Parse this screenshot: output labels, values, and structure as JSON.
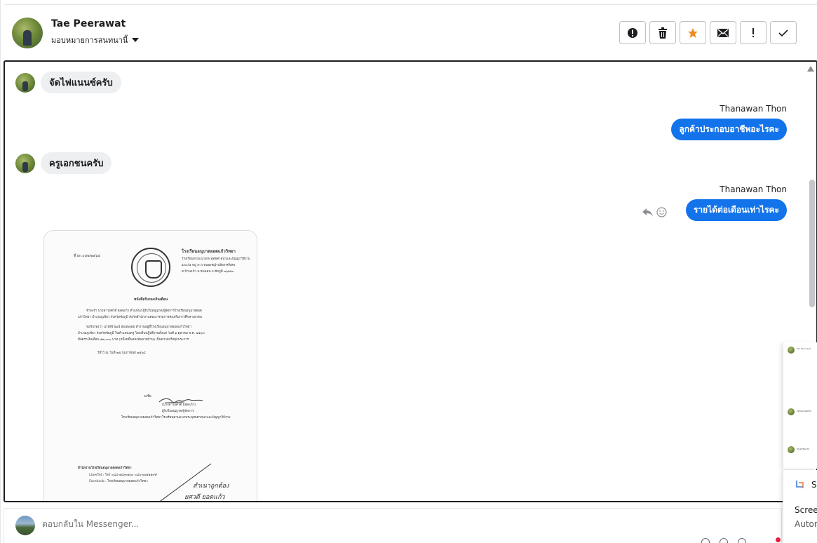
{
  "header": {
    "contact_name": "Tae Peerawat",
    "assign_label": "มอบหมายการสนทนานี้",
    "toolbar": [
      {
        "name": "spam-button",
        "icon": "alert-circle-icon"
      },
      {
        "name": "delete-button",
        "icon": "trash-icon"
      },
      {
        "name": "star-button",
        "icon": "star-icon",
        "color": "#f08a24"
      },
      {
        "name": "mark-unread-button",
        "icon": "envelope-icon"
      },
      {
        "name": "follow-up-button",
        "icon": "exclamation-icon"
      },
      {
        "name": "mark-done-button",
        "icon": "check-icon"
      }
    ]
  },
  "messages": [
    {
      "direction": "in",
      "text": "จัดไฟแนนซ์ครับ"
    },
    {
      "direction": "out",
      "sender": "Thanawan Thon",
      "text": "ลูกค้าประกอบอาชีพอะไรคะ"
    },
    {
      "direction": "in",
      "text": "ครูเอกชนครับ"
    },
    {
      "direction": "out",
      "sender": "Thanawan Thon",
      "text": "รายได้ต่อเดือนเท่าไรคะ"
    }
  ],
  "document": {
    "ref": "ที่ ยก.๐๔๒/๒๕๖๔",
    "school": "โรงเรียนอนุบาลยอดแก้ววิทยา",
    "addr1": "โรงเรียนตามแนวพระพุทธศาสนาและปัญญาวิถีงาม",
    "addr2": "๑๓๐/๕ หมู่ ๙ ถ.หนองหญ้าปล้อง-ศรีเทพ",
    "addr3": "ต.บ้านแก้ว อ.ชนแดน จ.ชัยภูมิ ๓๖๑๑๐",
    "heading": "หนังสือรับรองเงินเดือน",
    "p1a": "ข้าพเจ้า นางสาวยศวดี ยอดแก้ว ตำแหน่ง ผู้รับใบอนุญาต/ผู้จัดการโรงเรียนอนุบาลยอด",
    "p1b": "แก้ววิทยา อำเภอภูเขียว จังหวัดชัยภูมิ สังกัดสำนักงานคณะกรรมการส่งเสริมการศึกษาเอกชน",
    "p2a": "ขอรับรองว่า นายพีรวัฒน์ อ่อนพลอย ทำงานอยู่ที่โรงเรียนอนุบาลยอดแก้ววิทยา",
    "p2b": "อำเภอภูเขียว จังหวัดชัยภูมิ ในตำแหน่งครู โดยเริ่มปฏิบัติงานตั้งแต่ วันที่ ๑ ตุลาคม พ.ศ. ๒๕๖๓",
    "p2c": "มีอัตราเงินเดือน ๑๒,๐๐๐ บาท (หนึ่งหมื่นสองพันบาทถ้วน) เป็นความจริงทุกประการ",
    "date": "ให้ไว้ ณ วันที่ ๒๕ กุมภาพันธ์ ๒๕๖๔",
    "sig_label": "ลงชื่อ",
    "signer": "(นางสาวยศวดี ยอดแก้ว)",
    "signer_role": "ผู้รับใบอนุญาต/ผู้จัดการ",
    "signer_org": "โรงเรียนอนุบาลยอดแก้ววิทยาโรงเรียนตามแนวพระพุทธศาสนาและปัญญาวิถีงาม",
    "office": "สำนักงานโรงเรียนอนุบาลยอดแก้ววิทยา",
    "line_tel": "Line/Tel : โทร ๐๘๔-๑๔๓๐๑๖๐ ๐๘๖-๖๖๕๑๑๙๙",
    "facebook": "Facebook : โรงเรียนอนุบาลยอดแก้ววิทยา",
    "hand1": "สำเนาถูกต้อง",
    "hand2": "ยศวดี ยอดแก้ว"
  },
  "reply": {
    "placeholder": "ตอบกลับใน Messenger..."
  },
  "mini_window": {
    "title": "Tae Peerawat",
    "msg1": "จัดไฟแนนซ์ครับ",
    "msg2": "ครูเอกชนครับ"
  },
  "tooltip": {
    "snip_label": "Sn",
    "line1": "Scree",
    "line2": "Autor"
  }
}
